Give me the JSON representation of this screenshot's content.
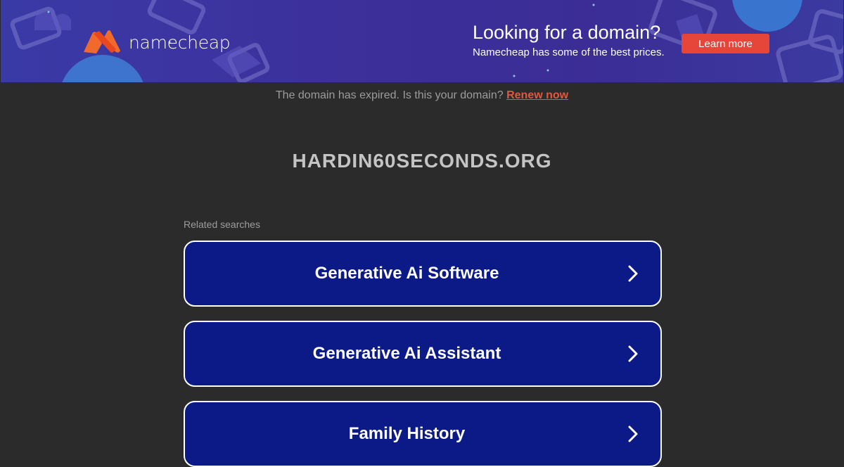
{
  "banner": {
    "logo_text": "namecheap",
    "headline": "Looking for a domain?",
    "subtext": "Namecheap has some of the best prices.",
    "cta_label": "Learn more",
    "colors": {
      "accent": "#e6463a",
      "logo_orange": "#f26a2b",
      "background": "#3b2f9c"
    }
  },
  "notice": {
    "text": "The domain has expired. Is this your domain?",
    "link_label": "Renew now",
    "link_color": "#e6563f"
  },
  "domain": {
    "name": "HARDIN60SECONDS.ORG"
  },
  "related": {
    "label": "Related searches",
    "items": [
      {
        "label": "Generative Ai Software",
        "icon": "chevron-right-icon"
      },
      {
        "label": "Generative Ai Assistant",
        "icon": "chevron-right-icon"
      },
      {
        "label": "Family History",
        "icon": "chevron-right-icon"
      }
    ],
    "button_color": "#0b1a86"
  }
}
